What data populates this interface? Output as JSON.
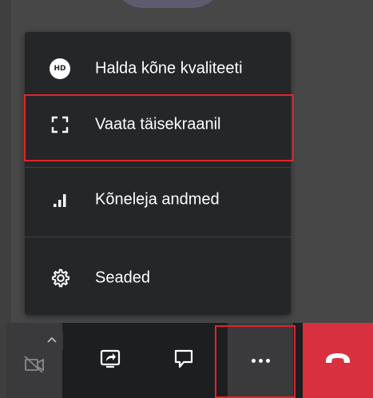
{
  "menu": {
    "items": [
      {
        "label": "Halda kõne kvaliteeti",
        "icon": "hd-icon",
        "icon_text": "HD"
      },
      {
        "label": "Vaata täisekraanil",
        "icon": "fullscreen-icon"
      },
      {
        "label": "Kõneleja andmed",
        "icon": "signal-bars-icon"
      },
      {
        "label": "Seaded",
        "icon": "gear-icon"
      }
    ]
  },
  "toolbar": {
    "buttons": [
      {
        "name": "camera-off",
        "icon": "camera-off-icon"
      },
      {
        "name": "camera-options",
        "icon": "chevron-up-icon"
      },
      {
        "name": "share-screen",
        "icon": "share-screen-icon"
      },
      {
        "name": "chat",
        "icon": "chat-icon"
      },
      {
        "name": "more",
        "icon": "more-dots-icon"
      },
      {
        "name": "hang-up",
        "icon": "phone-hangup-icon"
      }
    ]
  },
  "colors": {
    "menu_bg": "#252627",
    "toolbar_bg": "#1d1e20",
    "hangup": "#d8303f",
    "highlight": "#e0242b",
    "text": "#ffffff"
  }
}
